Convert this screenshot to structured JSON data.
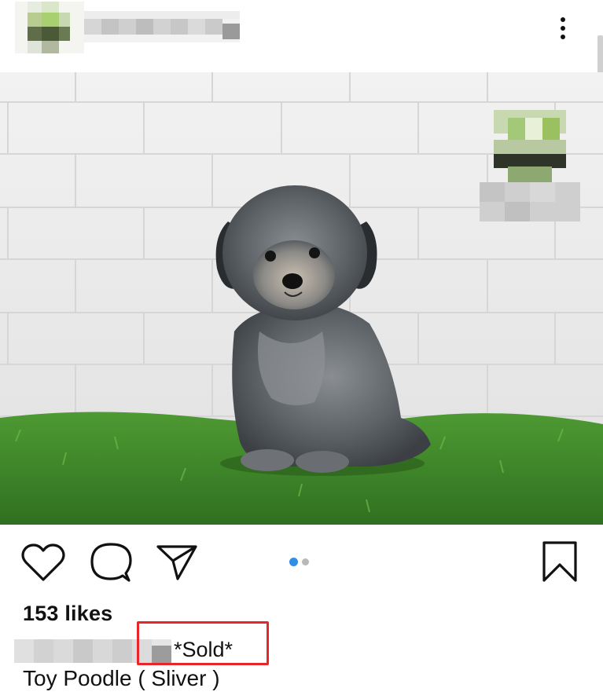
{
  "post": {
    "likes_text": "153 likes",
    "caption_status": "*Sold*",
    "caption_description": "Toy Poodle ( Sliver )"
  },
  "icons": {
    "like": "heart-icon",
    "comment": "comment-bubble-icon",
    "share": "paper-plane-icon",
    "save": "bookmark-icon",
    "more": "more-vertical-icon"
  },
  "carousel": {
    "total_images": 2,
    "active_index": 1
  },
  "colors": {
    "carousel_active": "#2f8fe6",
    "carousel_inactive": "#b8b8b8",
    "annotation_box": "#e8262a",
    "grass": "#3f8a2a",
    "wall": "#ececec"
  }
}
